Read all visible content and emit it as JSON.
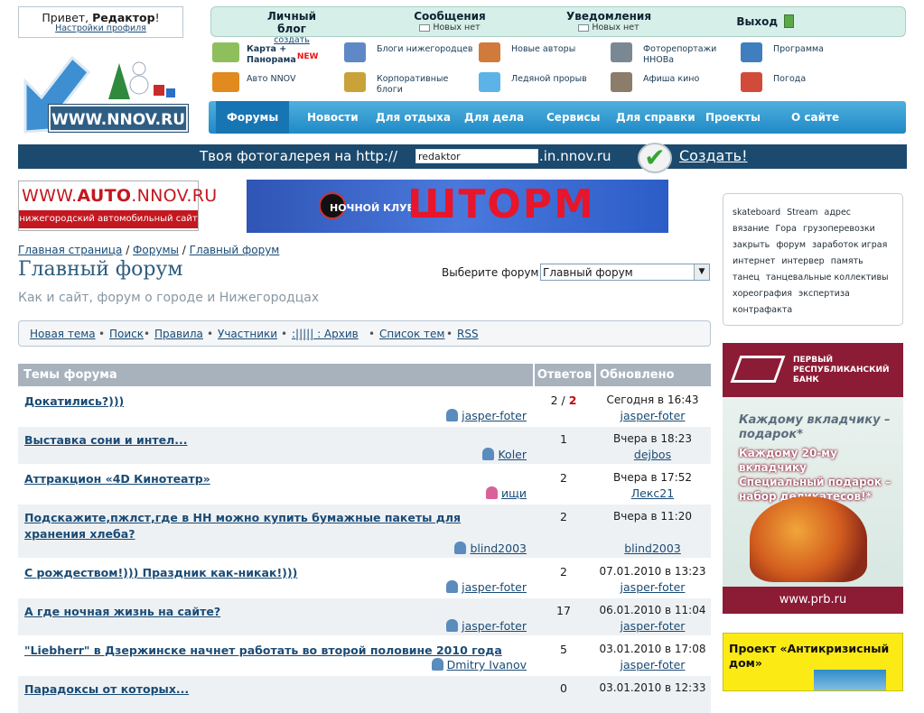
{
  "greeting": {
    "prefix": "Привет, ",
    "user": "Редактор",
    "suffix": "!",
    "settings": "Настройки профиля"
  },
  "logo": {
    "text": "WWW.NNOV.RU"
  },
  "topnav": [
    {
      "title": "Личный блог",
      "sub": "создать",
      "sub_link": true
    },
    {
      "title": "Сообщения",
      "sub": "Новых нет",
      "sub_link": false
    },
    {
      "title": "Уведомления",
      "sub": "Новых нет",
      "sub_link": false
    },
    {
      "title": "Выход",
      "sub": "",
      "sub_link": false
    }
  ],
  "services": [
    {
      "label1": "Карта +",
      "label2": "Панорама",
      "badge": "NEW",
      "icon": "map-icon",
      "color": "#8fbf5c"
    },
    {
      "label1": "Блоги нижегородцев",
      "label2": "",
      "badge": "",
      "icon": "blog-pen-icon",
      "color": "#5f88c7"
    },
    {
      "label1": "Новые авторы",
      "label2": "",
      "badge": "",
      "icon": "authors-icon",
      "color": "#d07a3b"
    },
    {
      "label1": "Фоторепортажи",
      "label2": "ННОВа",
      "badge": "",
      "icon": "camera-icon",
      "color": "#7a8894"
    },
    {
      "label1": "Программа",
      "label2": "",
      "badge": "",
      "icon": "tv-icon",
      "color": "#3f7fbf"
    },
    {
      "label1": "Авто NNOV",
      "label2": "",
      "badge": "",
      "icon": "car-icon",
      "color": "#e08a1f"
    },
    {
      "label1": "Корпоративные",
      "label2": "блоги",
      "badge": "",
      "icon": "corp-blog-icon",
      "color": "#c9a23a"
    },
    {
      "label1": "Ледяной прорыв",
      "label2": "",
      "badge": "",
      "icon": "ice-cup-icon",
      "color": "#5db3e6"
    },
    {
      "label1": "Афиша кино",
      "label2": "",
      "badge": "",
      "icon": "cinema-icon",
      "color": "#8c7c6a"
    },
    {
      "label1": "Погода",
      "label2": "",
      "badge": "",
      "icon": "umbrella-icon",
      "color": "#d24a3a"
    }
  ],
  "menu": [
    "Форумы",
    "Новости",
    "Для отдыха",
    "Для дела",
    "Сервисы",
    "Для справки",
    "Проекты",
    "О сайте"
  ],
  "gallery": {
    "prefix": "Твоя фотогалерея на http://",
    "value": "redaktor",
    "suffix": ".in.nnov.ru",
    "create": "Создать!"
  },
  "banners": {
    "auto_1": "WWW.",
    "auto_2": "AUTO",
    "auto_3": ".NNOV.RU",
    "auto_sub": "нижегородский автомобильный сайт",
    "storm_1": "НОЧНОЙ КЛУБ",
    "storm_2": "ШТОРМ"
  },
  "breadcrumbs": [
    "Главная страница",
    "Форумы",
    "Главный форум"
  ],
  "page_title": "Главный форум",
  "page_subtitle": "Как и сайт, форум о городе и Нижегородцах",
  "forum_select": {
    "label": "Выберите форум:",
    "value": "Главный форум"
  },
  "toolbar": [
    "Новая тема",
    "Поиск",
    "Правила",
    "Участники",
    ":||||| : Архив",
    "Список тем",
    "RSS"
  ],
  "table": {
    "headers": [
      "Темы форума",
      "Ответов",
      "Обновлено"
    ],
    "rows": [
      {
        "title": "Докатились?)))",
        "author": "jasper-foter",
        "female": false,
        "replies": "2",
        "replies_new": "2",
        "updated": "Сегодня в 16:43",
        "last": "jasper-foter"
      },
      {
        "title": "Выставка сони и интел...",
        "author": "Koler",
        "female": false,
        "replies": "1",
        "replies_new": "",
        "updated": "Вчера в 18:23",
        "last": "dejbos"
      },
      {
        "title": "Аттракцион «4D Кинотеатр»",
        "author": "ищи",
        "female": true,
        "replies": "2",
        "replies_new": "",
        "updated": "Вчера в 17:52",
        "last": "Лекс21"
      },
      {
        "title": "Подскажите,пжлст,где в НН можно купить бумажные пакеты для хранения хлеба?",
        "author": "blind2003",
        "female": false,
        "replies": "2",
        "replies_new": "",
        "updated": "Вчера в 11:20",
        "last": "blind2003"
      },
      {
        "title": "С рождеством!))) Праздник как-никак!)))",
        "author": "jasper-foter",
        "female": false,
        "replies": "2",
        "replies_new": "",
        "updated": "07.01.2010 в 13:23",
        "last": "jasper-foter"
      },
      {
        "title": "А где ночная жизнь на сайте?",
        "author": "jasper-foter",
        "female": false,
        "replies": "17",
        "replies_new": "",
        "updated": "06.01.2010 в 11:04",
        "last": "jasper-foter"
      },
      {
        "title": "\"Liebherr\" в Дзержинске начнет работать во второй половине 2010 года",
        "author": "Dmitry Ivanov",
        "female": false,
        "replies": "5",
        "replies_new": "",
        "updated": "03.01.2010 в 17:08",
        "last": "jasper-foter"
      },
      {
        "title": "Парадоксы от которых...",
        "author": "",
        "female": false,
        "replies": "0",
        "replies_new": "",
        "updated": "03.01.2010 в 12:33",
        "last": ""
      }
    ]
  },
  "tags": [
    "skateboard",
    "Stream",
    "адрес",
    "вязание",
    "Гора",
    "грузоперевозки",
    "закрыть",
    "форум",
    "заработок играя",
    "интернет",
    "интервер",
    "память",
    "танец",
    "танцевальные коллективы",
    "хореография",
    "экспертиза",
    "контрафакта"
  ],
  "prb": {
    "bank1": "ПЕРВЫЙ",
    "bank2": "РЕСПУБЛИКАНСКИЙ",
    "bank3": "БАНК",
    "promo1": "Каждому вкладчику – подарок*",
    "promo2": "Каждому 20-му вкладчику Специальный подарок – набор деликатесов!*",
    "url": "www.prb.ru"
  },
  "anti": {
    "text": "Проект «Антикризисный дом»"
  }
}
